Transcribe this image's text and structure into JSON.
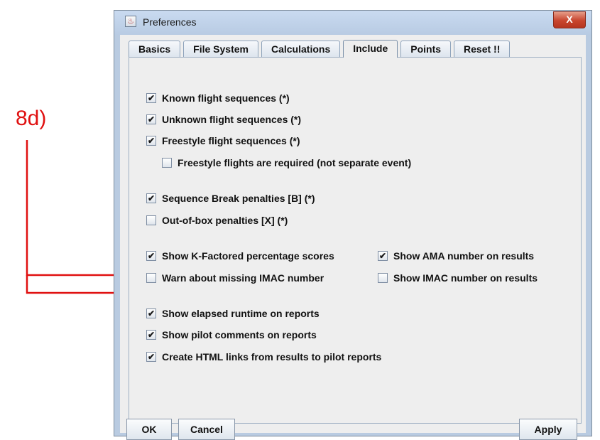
{
  "annotation": {
    "label": "8d)",
    "color": "#e01010"
  },
  "window": {
    "title": "Preferences",
    "close_glyph": "X"
  },
  "tabs": [
    {
      "label": "Basics",
      "active": false
    },
    {
      "label": "File System",
      "active": false
    },
    {
      "label": "Calculations",
      "active": false
    },
    {
      "label": "Include",
      "active": true
    },
    {
      "label": "Points",
      "active": false
    },
    {
      "label": "Reset !!",
      "active": false
    }
  ],
  "options": [
    {
      "label": "Known flight sequences (*)",
      "checked": true
    },
    {
      "label": "Unknown flight sequences (*)",
      "checked": true
    },
    {
      "label": "Freestyle flight sequences (*)",
      "checked": true
    },
    {
      "label": "Freestyle flights are required (not separate event)",
      "checked": false
    },
    {
      "label": "Sequence Break penalties [B] (*)",
      "checked": true
    },
    {
      "label": "Out-of-box penalties [X] (*)",
      "checked": false
    },
    {
      "label": "Show K-Factored percentage scores",
      "checked": true
    },
    {
      "label": "Show AMA number on results",
      "checked": true
    },
    {
      "label": "Warn about missing IMAC number",
      "checked": false
    },
    {
      "label": "Show IMAC number on results",
      "checked": false
    },
    {
      "label": "Show elapsed runtime on reports",
      "checked": true
    },
    {
      "label": "Show pilot comments on reports",
      "checked": true
    },
    {
      "label": "Create HTML links from results to pilot reports",
      "checked": true
    }
  ],
  "buttons": {
    "ok": "OK",
    "cancel": "Cancel",
    "apply": "Apply"
  },
  "check_glyph": "✔"
}
